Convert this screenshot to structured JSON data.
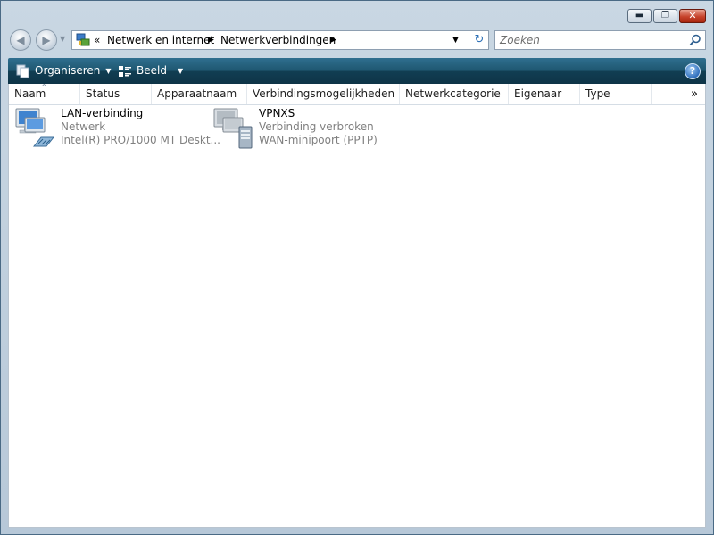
{
  "window": {
    "buttons": {
      "minimize": "▬",
      "maximize": "❐",
      "close": "✕"
    }
  },
  "nav": {
    "back_icon": "back-arrow-icon",
    "forward_icon": "forward-arrow-icon",
    "back_glyph": "◀",
    "forward_glyph": "▶",
    "recent_glyph": "▼"
  },
  "address": {
    "overflow": "«",
    "segments": [
      "Netwerk en internet",
      "Netwerkverbindingen"
    ],
    "separator": "▶",
    "dropdown": "▼",
    "refresh": "↻"
  },
  "search": {
    "placeholder": "Zoeken"
  },
  "toolbar": {
    "organise_label": "Organiseren",
    "view_label": "Beeld",
    "caret": "▼",
    "help": "?"
  },
  "columns": [
    "Naam",
    "Status",
    "Apparaatnaam",
    "Verbindingsmogelijkheden",
    "Netwerkcategorie",
    "Eigenaar",
    "Type"
  ],
  "columns_more": "»",
  "sort_indicator": "^",
  "items": [
    {
      "name": "LAN-verbinding",
      "status": "Netwerk",
      "device": "Intel(R) PRO/1000 MT Deskt...",
      "icon": "lan-connection-icon"
    },
    {
      "name": "VPNXS",
      "status": "Verbinding verbroken",
      "device": "WAN-minipoort (PPTP)",
      "icon": "vpn-connection-icon"
    }
  ],
  "colors": {
    "toolbar": "#1e566f",
    "subtext": "#808080",
    "close_button": "#c7432c"
  }
}
